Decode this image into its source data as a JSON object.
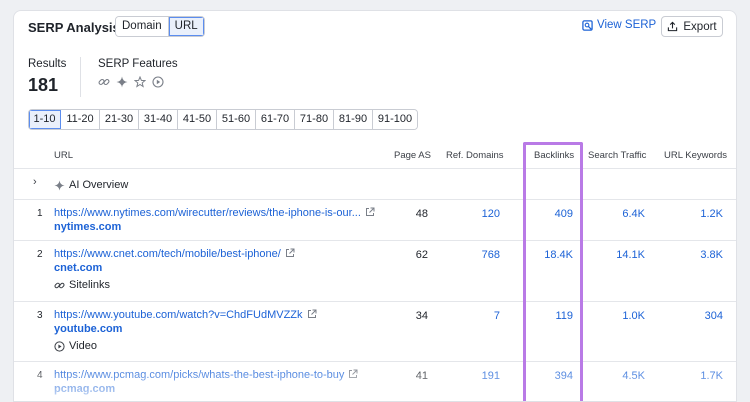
{
  "header": {
    "title": "SERP Analysis",
    "tabs": [
      "Domain",
      "URL"
    ],
    "view_serp": "View SERP",
    "export": "Export"
  },
  "summary": {
    "results_label": "Results",
    "results_value": "181",
    "serp_features_label": "SERP Features",
    "feature_icons": [
      "link-icon",
      "sparkle-icon",
      "star-icon",
      "play-circle-icon"
    ]
  },
  "pagination": [
    "1-10",
    "11-20",
    "21-30",
    "31-40",
    "41-50",
    "51-60",
    "61-70",
    "71-80",
    "81-90",
    "91-100"
  ],
  "table": {
    "columns": [
      "URL",
      "Page AS",
      "Ref. Domains",
      "Backlinks",
      "Search Traffic",
      "URL Keywords"
    ],
    "ai_overview": "AI Overview",
    "rows": [
      {
        "num": "1",
        "url": "https://www.nytimes.com/wirecutter/reviews/the-iphone-is-our...",
        "domain": "nytimes.com",
        "page_as": "48",
        "ref_domains": "120",
        "backlinks": "409",
        "traffic": "6.4K",
        "keywords": "1.2K",
        "feature": ""
      },
      {
        "num": "2",
        "url": "https://www.cnet.com/tech/mobile/best-iphone/",
        "domain": "cnet.com",
        "page_as": "62",
        "ref_domains": "768",
        "backlinks": "18.4K",
        "traffic": "14.1K",
        "keywords": "3.8K",
        "feature": "Sitelinks"
      },
      {
        "num": "3",
        "url": "https://www.youtube.com/watch?v=ChdFUdMVZZk",
        "domain": "youtube.com",
        "page_as": "34",
        "ref_domains": "7",
        "backlinks": "119",
        "traffic": "1.0K",
        "keywords": "304",
        "feature": "Video"
      },
      {
        "num": "4",
        "url": "https://www.pcmag.com/picks/whats-the-best-iphone-to-buy",
        "domain": "pcmag.com",
        "page_as": "41",
        "ref_domains": "191",
        "backlinks": "394",
        "traffic": "4.5K",
        "keywords": "1.7K",
        "feature": ""
      }
    ]
  },
  "colors": {
    "accent": "#1c62d6",
    "highlight": "#b97ae6"
  }
}
